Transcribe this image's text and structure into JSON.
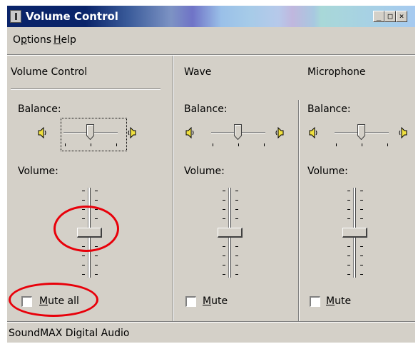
{
  "window": {
    "title": "Volume Control",
    "buttons": {
      "minimize": "_",
      "maximize": "□",
      "close": "×"
    }
  },
  "menu": [
    {
      "label": "Options",
      "mnemonic": "p",
      "pre": "O",
      "post": "tions"
    },
    {
      "label": "Help",
      "mnemonic": "H",
      "pre": "",
      "post": "elp"
    }
  ],
  "columns": [
    {
      "title": "Volume Control",
      "balance_label": "Balance:",
      "volume_label": "Volume:",
      "mute_pre": "",
      "mute_u": "M",
      "mute_post": "ute all",
      "muted": false,
      "balance_level": 0.5,
      "volume_level": 0.5
    },
    {
      "title": "Wave",
      "balance_label": "Balance:",
      "volume_label": "Volume:",
      "mute_pre": "",
      "mute_u": "M",
      "mute_post": "ute",
      "muted": false,
      "balance_level": 0.5,
      "volume_level": 0.5
    },
    {
      "title": "Microphone",
      "balance_label": "Balance:",
      "volume_label": "Volume:",
      "mute_pre": "",
      "mute_u": "M",
      "mute_post": "ute",
      "muted": false,
      "balance_level": 0.5,
      "volume_level": 0.5
    }
  ],
  "status": {
    "text": "SoundMAX Digital Audio"
  },
  "annotation_color": "#e8000a"
}
